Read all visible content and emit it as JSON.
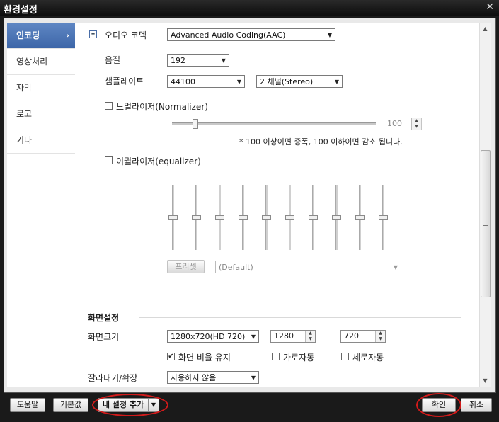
{
  "window": {
    "title": "환경설정"
  },
  "sidebar": {
    "items": [
      {
        "label": "인코딩",
        "active": true
      },
      {
        "label": "영상처리"
      },
      {
        "label": "자막"
      },
      {
        "label": "로고"
      },
      {
        "label": "기타"
      }
    ]
  },
  "audio": {
    "codec_label": "오디오 코덱",
    "codec_value": "Advanced Audio Coding(AAC)",
    "quality_label": "음질",
    "quality_value": "192",
    "samplerate_label": "샘플레이트",
    "samplerate_value": "44100",
    "channel_value": "2 채널(Stereo)",
    "normalizer_label": "노멀라이저(Normalizer)",
    "normalizer_checked": false,
    "normalizer_value": "100",
    "normalizer_level": 0.11,
    "normalizer_note": "* 100 이상이면 증폭, 100 이하이면 감소 됩니다.",
    "equalizer_label": "이퀄라이저(equalizer)",
    "equalizer_checked": false,
    "equalizer_bands": [
      0.5,
      0.5,
      0.5,
      0.5,
      0.5,
      0.5,
      0.5,
      0.5,
      0.5,
      0.5
    ],
    "preset_button": "프리셋",
    "preset_value": "(Default)"
  },
  "screen": {
    "section_title": "화면설정",
    "size_label": "화면크기",
    "size_value": "1280x720(HD 720)",
    "width_value": "1280",
    "height_value": "720",
    "keep_ratio_label": "화면 비율 유지",
    "keep_ratio_checked": true,
    "auto_width_label": "가로자동",
    "auto_width_checked": false,
    "auto_height_label": "세로자동",
    "auto_height_checked": false,
    "crop_label": "잘라내기/확장",
    "crop_value": "사용하지 않음"
  },
  "footer": {
    "help": "도움말",
    "default": "기본값",
    "add_my_setting": "내 설정 추가",
    "ok": "확인",
    "cancel": "취소"
  },
  "colors": {
    "accent": "#4a72b3",
    "highlight_circle": "#d21a1a"
  }
}
